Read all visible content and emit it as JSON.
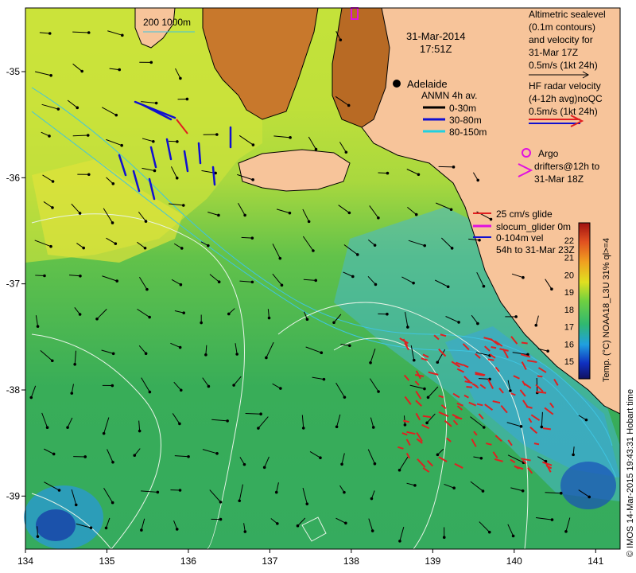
{
  "map": {
    "title_date": "31-Mar-2014",
    "title_time": "17:51Z",
    "lon_ticks": [
      "134",
      "135",
      "136",
      "137",
      "138",
      "139",
      "140",
      "141"
    ],
    "lat_ticks": [
      "-35",
      "-36",
      "-37",
      "-38",
      "-39"
    ],
    "lon_range": [
      134,
      141.3
    ],
    "lat_range": [
      -34.4,
      -39.5
    ],
    "city": "Adelaide",
    "bathymetry_label": "200  1000m",
    "colors": {
      "land": "#f7c49a",
      "ocean_warm": "#b5e23c",
      "ocean_cool": "#2fae5b",
      "ocean_cold": "#47b8d6",
      "contours": "#e8f4e8",
      "radar": "#e02020",
      "argo": "#e010e0"
    }
  },
  "legend": {
    "altimetry_title_1": "Altimetric sealevel",
    "altimetry_title_2": "(0.1m contours)",
    "altimetry_title_3": "and velocity for",
    "altimetry_title_4": "31-Mar 17Z",
    "altimetry_scale": "0.5m/s (1kt 24h)",
    "radar_title_1": "HF radar velocity",
    "radar_title_2": "(4-12h avg)noQC",
    "radar_scale": "0.5m/s (1kt 24h)",
    "anmn_title": "ANMN 4h av.",
    "anmn_items": [
      {
        "label": "0-30m",
        "color": "#000000"
      },
      {
        "label": "30-80m",
        "color": "#1010d0"
      },
      {
        "label": "80-150m",
        "color": "#20d0e0"
      }
    ],
    "argo_1": "Argo",
    "argo_2": "drifters@12h to",
    "argo_3": "31-Mar 18Z",
    "glider_1": "25 cm/s glide",
    "glider_2": "slocum_glider 0m",
    "glider_3": "0-104m vel",
    "glider_4": "54h to 31-Mar 23Z"
  },
  "colorbar": {
    "ticks": [
      "22",
      "21",
      "20",
      "19",
      "18",
      "17",
      "16",
      "15"
    ],
    "label": "Temp. (°C) NOAA18_L3U 31% ql>=4",
    "range": [
      14,
      23
    ]
  },
  "side_text": "© IMOS 14-Mar-2015 19:43:31 Hobart time"
}
